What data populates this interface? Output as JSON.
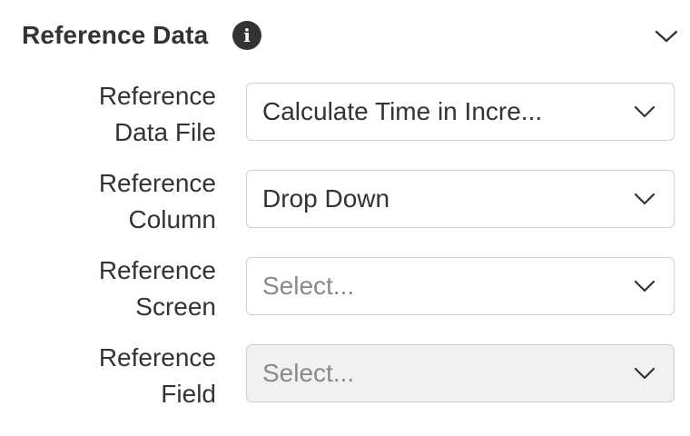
{
  "section": {
    "title": "Reference Data",
    "info_icon": "info-icon",
    "toggle_icon": "chevron-down-icon"
  },
  "fields": [
    {
      "label_line1": "Reference",
      "label_line2": "Data File",
      "value": "Calculate Time in Incre...",
      "is_placeholder": false,
      "disabled": false
    },
    {
      "label_line1": "Reference",
      "label_line2": "Column",
      "value": "Drop Down",
      "is_placeholder": false,
      "disabled": false
    },
    {
      "label_line1": "Reference",
      "label_line2": "Screen",
      "value": "Select...",
      "is_placeholder": true,
      "disabled": false
    },
    {
      "label_line1": "Reference",
      "label_line2": "Field",
      "value": "Select...",
      "is_placeholder": true,
      "disabled": true
    }
  ],
  "colors": {
    "text": "#333333",
    "placeholder": "#8a8a8a",
    "border": "#d0d0d0",
    "disabled_bg": "#f1f1f1"
  }
}
